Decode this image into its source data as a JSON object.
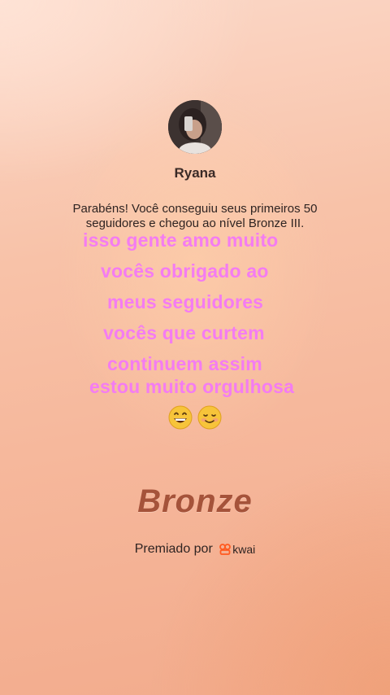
{
  "profile": {
    "name": "Ryana",
    "avatar_icon": "user-avatar-photo"
  },
  "message": {
    "line1": "Parabéns! Você conseguiu seus primeiros 50",
    "line2": "seguidores e chegou ao nível Bronze III."
  },
  "overlay_text": [
    "isso gente amo muito",
    "vocês obrigado ao",
    "meus seguidores",
    "vocês que curtem",
    "continuem assim",
    "estou muito orgulhosa"
  ],
  "emojis": [
    "grinning-face-emoji",
    "smiling-face-emoji"
  ],
  "badge": {
    "level": "Bronze",
    "color": "#a5533a"
  },
  "footer": {
    "label": "Premiado por",
    "brand": "kwai",
    "brand_icon": "kwai-logo-icon"
  },
  "colors": {
    "overlay_text": "#f47cf2",
    "background_top": "#fbd8c8",
    "background_bottom": "#f2ab8c"
  }
}
